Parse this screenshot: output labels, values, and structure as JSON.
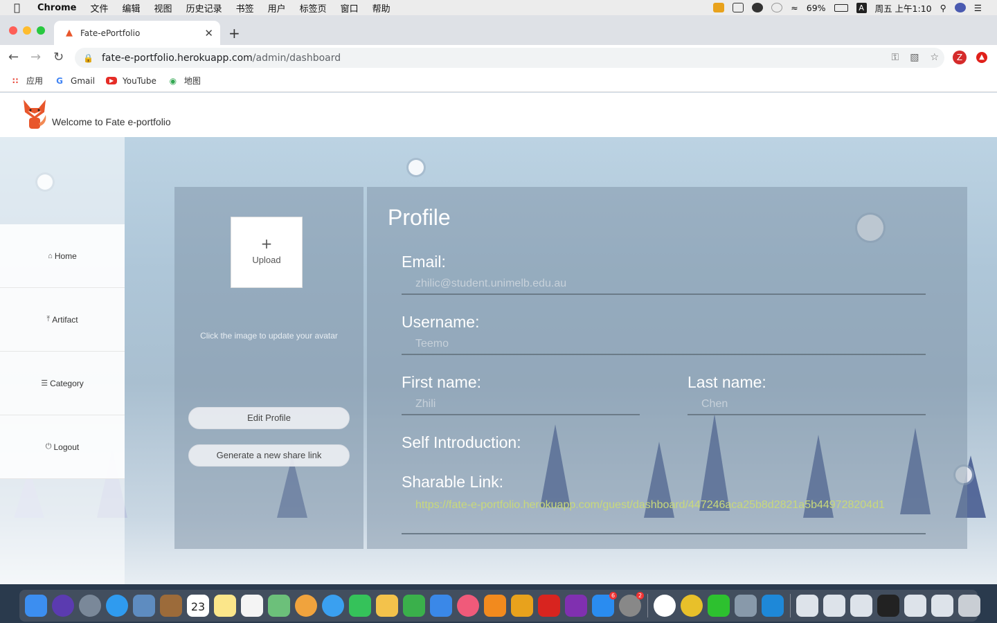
{
  "menubar": {
    "app": "Chrome",
    "items": [
      "文件",
      "编辑",
      "视图",
      "历史记录",
      "书签",
      "用户",
      "标签页",
      "窗口",
      "帮助"
    ],
    "battery": "69%",
    "input_method": "A",
    "clock": "周五 上午1:10"
  },
  "browser": {
    "tab_title": "Fate-ePortfolio",
    "url_host": "fate-e-portfolio.herokuapp.com",
    "url_path": "/admin/dashboard",
    "profile_initial": "Z",
    "bookmarks": [
      {
        "label": "应用",
        "icon": "apps-grid-icon"
      },
      {
        "label": "Gmail",
        "icon": "google-icon"
      },
      {
        "label": "YouTube",
        "icon": "youtube-icon"
      },
      {
        "label": "地图",
        "icon": "maps-icon"
      }
    ]
  },
  "header": {
    "welcome": "Welcome to Fate e-portfolio"
  },
  "sidebar": {
    "items": [
      {
        "label": "Home",
        "icon": "home-icon"
      },
      {
        "label": "Artifact",
        "icon": "upload-icon"
      },
      {
        "label": "Category",
        "icon": "list-icon"
      },
      {
        "label": "Logout",
        "icon": "power-icon"
      }
    ]
  },
  "avatar_panel": {
    "upload_plus": "+",
    "upload_label": "Upload",
    "hint": "Click the image to update your avatar",
    "edit_button": "Edit Profile",
    "share_button": "Generate a new share link"
  },
  "profile": {
    "title": "Profile",
    "email_label": "Email:",
    "email": "zhilic@student.unimelb.edu.au",
    "username_label": "Username:",
    "username": "Teemo",
    "first_name_label": "First name:",
    "first_name": "Zhili",
    "last_name_label": "Last name:",
    "last_name": "Chen",
    "intro_label": "Self Introduction:",
    "link_label": "Sharable Link:",
    "link": "https://fate-e-portfolio.herokuapp.com/guest/dashboard/447246aca25b8d2821a5b449728204d1"
  },
  "dock": {
    "calendar_day": "23",
    "badges": [
      "6",
      "2"
    ]
  }
}
